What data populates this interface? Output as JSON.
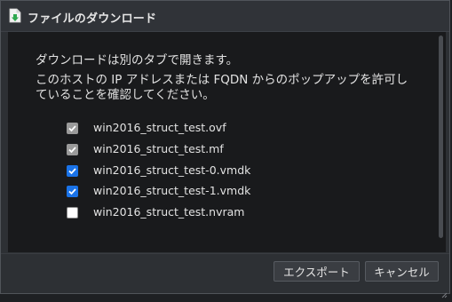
{
  "dialog": {
    "title": "ファイルのダウンロード",
    "title_icon": "file-download-icon"
  },
  "content": {
    "message_line1": "ダウンロードは別のタブで開きます。",
    "message_line2": "このホストの IP アドレスまたは FQDN からのポップアップを許可していることを確認してください。",
    "files": [
      {
        "name": "win2016_struct_test.ovf",
        "checked": true,
        "disabled": true
      },
      {
        "name": "win2016_struct_test.mf",
        "checked": true,
        "disabled": true
      },
      {
        "name": "win2016_struct_test-0.vmdk",
        "checked": true,
        "disabled": false
      },
      {
        "name": "win2016_struct_test-1.vmdk",
        "checked": true,
        "disabled": false
      },
      {
        "name": "win2016_struct_test.nvram",
        "checked": false,
        "disabled": false
      }
    ]
  },
  "footer": {
    "export_label": "エクスポート",
    "cancel_label": "キャンセル"
  },
  "colors": {
    "accent": "#1a73e8",
    "background": "#2d3034",
    "content_bg": "#191a1c"
  }
}
